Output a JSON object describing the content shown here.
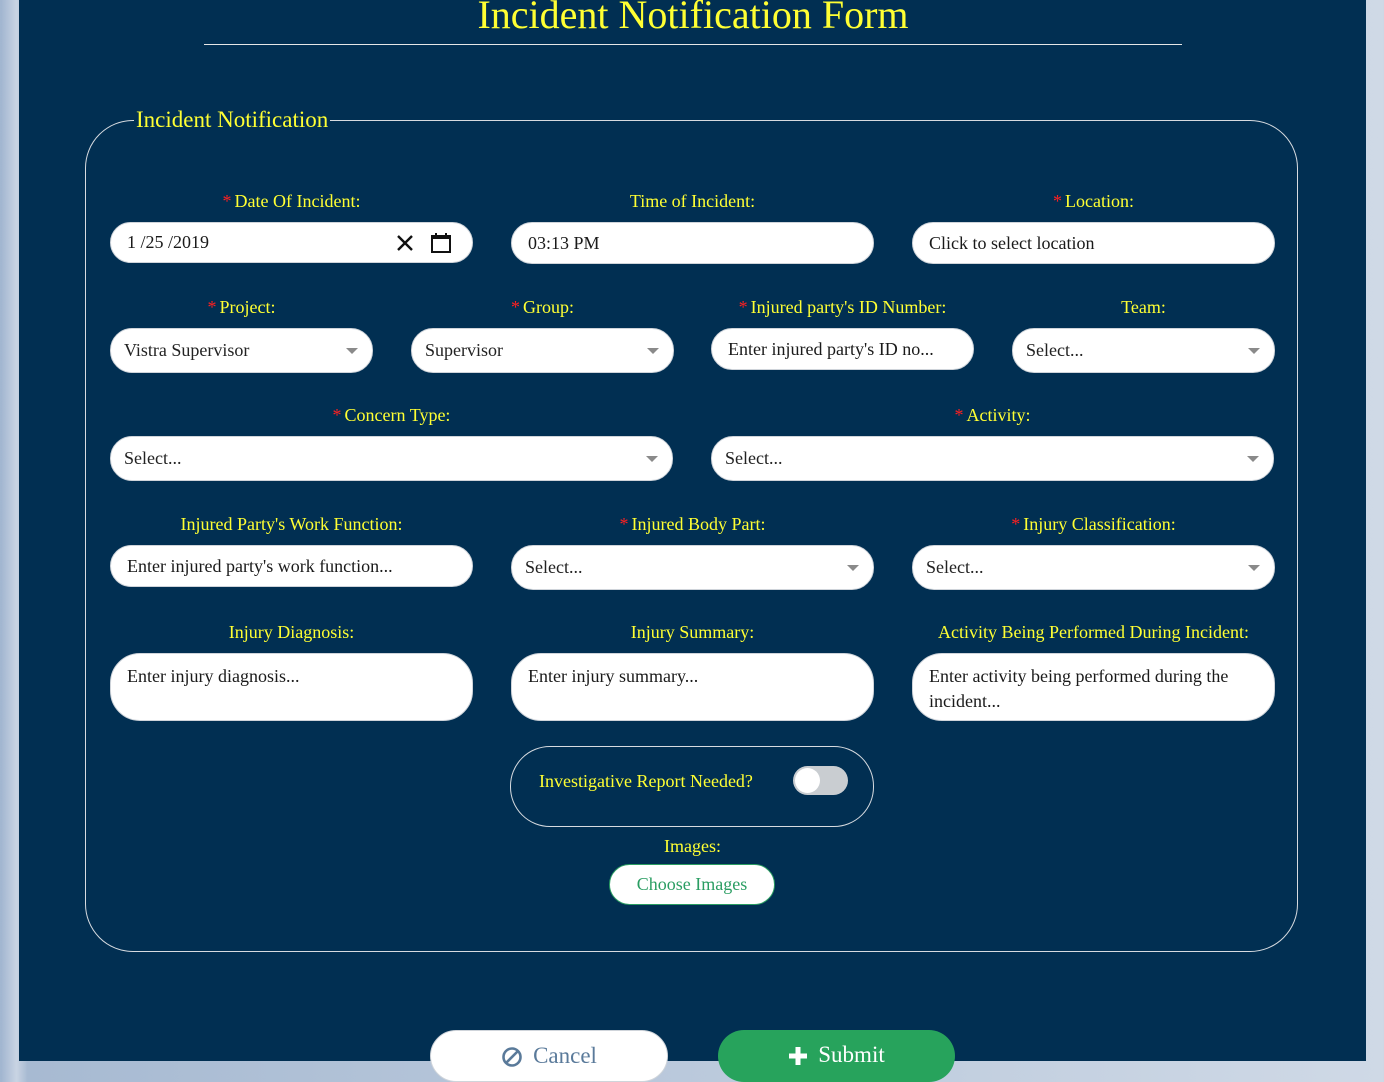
{
  "form": {
    "title": "Incident Notification Form",
    "legend": "Incident Notification"
  },
  "colors": {
    "background": "#012f52",
    "label": "#ffff33",
    "required_marker": "#ff2020",
    "submit": "#27a35c"
  },
  "fields": {
    "date": {
      "label": "Date Of Incident:",
      "required": "*",
      "value": "1 /25 /2019"
    },
    "time": {
      "label": "Time of Incident:",
      "value": "03:13 PM"
    },
    "location": {
      "label": "Location:",
      "required": "*",
      "placeholder": "Click to select location"
    },
    "project": {
      "label": "Project:",
      "required": "*",
      "value": "Vistra Supervisor"
    },
    "group": {
      "label": "Group:",
      "required": "*",
      "value": "Supervisor"
    },
    "injured_id": {
      "label": "Injured party's ID Number:",
      "required": "*",
      "placeholder": "Enter injured party's ID no..."
    },
    "team": {
      "label": "Team:",
      "value": "Select..."
    },
    "concern_type": {
      "label": "Concern Type:",
      "required": "*",
      "value": "Select..."
    },
    "activity": {
      "label": "Activity:",
      "required": "*",
      "value": "Select..."
    },
    "work_function": {
      "label": "Injured Party's Work Function:",
      "placeholder": "Enter injured party's work function..."
    },
    "body_part": {
      "label": "Injured Body Part:",
      "required": "*",
      "value": "Select..."
    },
    "injury_classification": {
      "label": "Injury Classification:",
      "required": "*",
      "value": "Select..."
    },
    "injury_diagnosis": {
      "label": "Injury Diagnosis:",
      "placeholder": "Enter injury diagnosis..."
    },
    "injury_summary": {
      "label": "Injury Summary:",
      "placeholder": "Enter injury summary..."
    },
    "activity_performed": {
      "label": "Activity Being Performed During Incident:",
      "placeholder": "Enter activity being performed during the incident..."
    },
    "investigative_report": {
      "label": "Investigative Report Needed?",
      "checked": false
    },
    "images": {
      "label": "Images:",
      "button": "Choose Images"
    }
  },
  "actions": {
    "cancel": "Cancel",
    "submit": "Submit"
  }
}
